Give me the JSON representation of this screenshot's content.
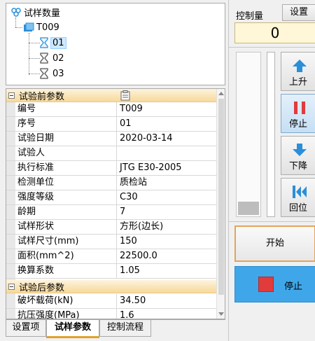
{
  "tree": {
    "root": "试样数量",
    "group": "T009",
    "samples": [
      "01",
      "02",
      "03"
    ],
    "selected": "01"
  },
  "grid": {
    "category1": "试验前参数",
    "rows1": [
      {
        "k": "编号",
        "v": "T009"
      },
      {
        "k": "序号",
        "v": "01"
      },
      {
        "k": "试验日期",
        "v": "2020-03-14"
      },
      {
        "k": "试验人",
        "v": ""
      },
      {
        "k": "执行标准",
        "v": "JTG E30-2005"
      },
      {
        "k": "检测单位",
        "v": "质检站"
      },
      {
        "k": "强度等级",
        "v": "C30"
      },
      {
        "k": "龄期",
        "v": "7"
      },
      {
        "k": "试样形状",
        "v": "方形(边长)"
      },
      {
        "k": "试样尺寸(mm)",
        "v": "150"
      },
      {
        "k": "面积(mm^2)",
        "v": "22500.0"
      },
      {
        "k": "换算系数",
        "v": "1.05"
      }
    ],
    "category2": "试验后参数",
    "rows2": [
      {
        "k": "破坏载荷(kN)",
        "v": "34.50"
      },
      {
        "k": "抗压强度(MPa)",
        "v": "1.6"
      }
    ]
  },
  "tabs": [
    {
      "label": "设置项",
      "active": false
    },
    {
      "label": "试样参数",
      "active": true
    },
    {
      "label": "控制流程",
      "active": false
    }
  ],
  "control": {
    "label": "控制量",
    "settings_label": "设置",
    "value": "0",
    "up_label": "上升",
    "pause_label": "停止",
    "down_label": "下降",
    "return_label": "回位",
    "start_label": "开始",
    "stop_label": "停止",
    "meter_level": 0.08
  },
  "colors": {
    "accent_blue": "#2a8fd8",
    "stop_blue": "#3fa7e9",
    "stop_red": "#e23b3b",
    "category_bg": "#f7d99a",
    "active_tab_underline": "#e1a22a"
  }
}
